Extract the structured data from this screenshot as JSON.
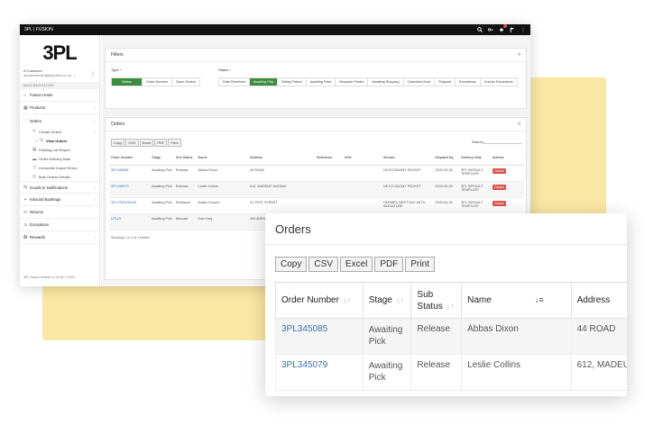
{
  "app": {
    "title": "3PL | FUSION",
    "logo": "3PL",
    "customer_name": "A Customer",
    "customer_email": "acustomer@3plexpress.co.uk",
    "main_nav_label": "MAIN NAVIGATION",
    "version": "3PL Fusion Version v1.34.62 © 2023"
  },
  "sidebar": {
    "items": [
      {
        "label": "Fusion Home",
        "icon": "home-icon"
      },
      {
        "label": "Products",
        "icon": "products-icon",
        "chevron": "‹"
      },
      {
        "label": "Orders",
        "icon": "folder-icon",
        "chevron": "‹"
      }
    ],
    "order_subitems": [
      {
        "label": "Create Orders",
        "icon": "pencil-icon",
        "chevron": "‹"
      },
      {
        "label": "View Orders",
        "icon": "list-icon",
        "arrow": "›"
      },
      {
        "label": "Packing List Report",
        "icon": "report-icon"
      },
      {
        "label": "Order Delivery Note",
        "icon": "note-icon"
      },
      {
        "label": "Linnworks Import Errors",
        "icon": "info-icon"
      },
      {
        "label": "Bulk Orders Details",
        "icon": "clock-icon"
      }
    ],
    "lower_items": [
      {
        "label": "Goods In Notifications",
        "icon": "goods-in-icon",
        "chevron": "‹"
      },
      {
        "label": "Inbound Bookings",
        "icon": "inbound-icon",
        "chevron": "‹"
      },
      {
        "label": "Returns",
        "icon": "returns-icon"
      },
      {
        "label": "Exceptions",
        "icon": "warning-icon"
      },
      {
        "label": "Rewards",
        "icon": "rewards-icon",
        "chevron": "‹"
      }
    ]
  },
  "filters": {
    "title": "Filters",
    "type_label": "Type *",
    "type_options": [
      "Status",
      "Order Number",
      "Open Orders"
    ],
    "type_selected": "Status",
    "status_label": "Status *",
    "status_options": [
      "Date Received",
      "Awaiting Pick",
      "Being Picked",
      "Awaiting Pack",
      "Bespoke Printer",
      "Awaiting Shipping",
      "Collection Area",
      "Shipped",
      "Exceptions",
      "Courier Exceptions"
    ],
    "status_selected": "Awaiting Pick"
  },
  "orders": {
    "title": "Orders",
    "export_buttons": [
      "Copy",
      "CSV",
      "Excel",
      "PDF",
      "Print"
    ],
    "search_label": "Search:",
    "columns": [
      "Order Number",
      "Stage",
      "Sub Status",
      "Name",
      "Address",
      "Reference",
      "ASN",
      "Service",
      "Dispatch By",
      "Delivery Note",
      "Actions"
    ],
    "rows": [
      {
        "order": "3PL345085",
        "stage": "Awaiting Pick",
        "sub": "Release",
        "name": "Abbas Dixon",
        "address": "44 ROAD",
        "ref": "",
        "asn": "",
        "service": "UK ECONOMY PACKET",
        "dispatch": "2020-03-30",
        "note": "3PL DEFAULT TEMPLATE",
        "action": "Cancel"
      },
      {
        "order": "3PL345079",
        "stage": "Awaiting Pick",
        "sub": "Release",
        "name": "Leslie Collins",
        "address": "612, MADEUP AVENUE",
        "ref": "",
        "asn": "",
        "service": "UK ECONOMY PACKET",
        "dispatch": "2020-03-30",
        "note": "3PL DEFAULT TEMPLATE",
        "action": "Cancel"
      },
      {
        "order": "3PL2763104043",
        "stage": "Awaiting Pick",
        "sub": "Released",
        "name": "Isaiah Chavez",
        "address": "31 TEST STREET",
        "ref": "",
        "asn": "",
        "service": "HERMES NEXT DAY WITH SIGNATURE",
        "dispatch": "2020-04-30",
        "note": "3PL DEFAULT TEMPLATE",
        "action": "Cancel"
      },
      {
        "order": "LP123",
        "stage": "Awaiting Pick",
        "sub": "Allocate",
        "name": "Kort King",
        "address": "300 AVEN",
        "ref": "",
        "asn": "",
        "service": "",
        "dispatch": "",
        "note": "",
        "action": ""
      }
    ],
    "showing": "Showing 1 to 4 of 4 entries"
  },
  "zoom": {
    "title": "Orders",
    "export_buttons": [
      "Copy",
      "CSV",
      "Excel",
      "PDF",
      "Print"
    ],
    "columns": [
      "Order Number",
      "Stage",
      "Sub Status",
      "Name",
      "Address"
    ],
    "rows": [
      {
        "order": "3PL345085",
        "stage": "Awaiting Pick",
        "sub": "Release",
        "name": "Abbas Dixon",
        "address": "44 ROAD"
      },
      {
        "order": "3PL345079",
        "stage": "Awaiting Pick",
        "sub": "Release",
        "name": "Leslie Collins",
        "address": "612, MADEU"
      }
    ]
  },
  "colors": {
    "accent_green": "#3c8d3f",
    "cancel_red": "#d9534f",
    "link_blue": "#3a6fb0",
    "backdrop_yellow": "#fbe7a4",
    "topbar": "#111111"
  }
}
